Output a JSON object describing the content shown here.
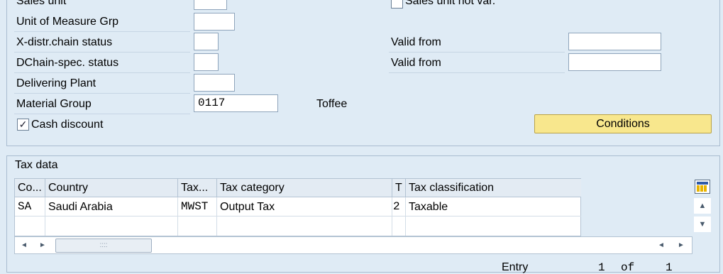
{
  "fields": {
    "sales_unit": "Sales unit",
    "unit_of_measure_grp": "Unit of Measure Grp",
    "x_distr_chain_status": "X-distr.chain status",
    "dchain_spec_status": "DChain-spec. status",
    "delivering_plant": "Delivering Plant",
    "material_group": "Material Group",
    "material_group_value": "0117",
    "material_group_desc": "Toffee",
    "cash_discount": "Cash discount",
    "cash_discount_checked": true,
    "sales_unit_not_var": "Sales unit not var.",
    "valid_from_1": "Valid from",
    "valid_from_2": "Valid from"
  },
  "buttons": {
    "conditions": "Conditions"
  },
  "tax": {
    "title": "Tax data",
    "headers": [
      "Co...",
      "Country",
      "Tax...",
      "Tax category",
      "T",
      "Tax classification"
    ],
    "rows": [
      [
        "SA",
        "Saudi Arabia",
        "MWST",
        "Output Tax",
        "2",
        "Taxable"
      ]
    ]
  },
  "footer": {
    "entry_label": "Entry",
    "current": "1",
    "of_label": "of",
    "total": "1"
  },
  "icons": {
    "checkmark": "✓",
    "scroll_left": "◄",
    "scroll_right": "►",
    "scroll_up": "▲",
    "scroll_down": "▼",
    "thumb_grip": "::::",
    "table_settings": "table-settings-icon"
  }
}
